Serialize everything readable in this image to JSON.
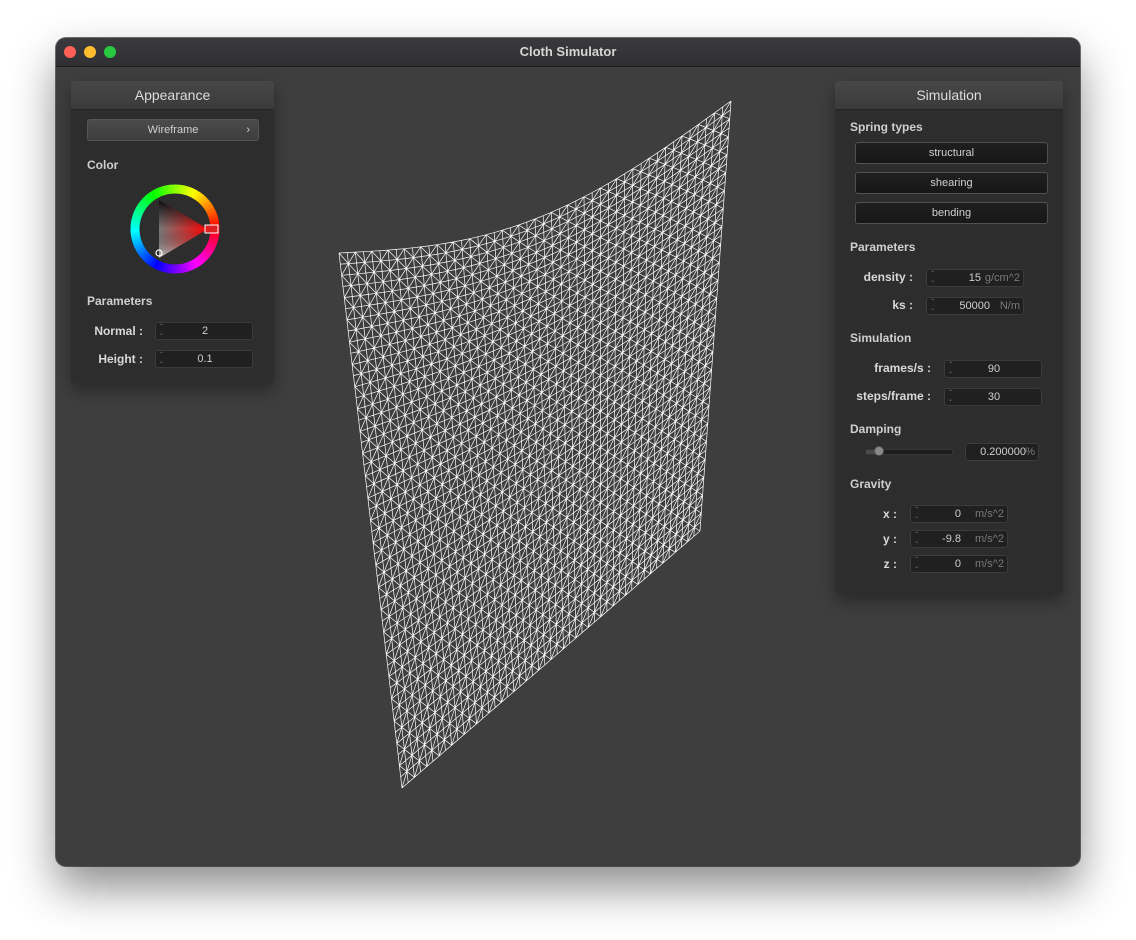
{
  "window": {
    "title": "Cloth Simulator"
  },
  "appearance": {
    "title": "Appearance",
    "mode_button": "Wireframe",
    "color_label": "Color",
    "selected_color": "#ff0000",
    "parameters_label": "Parameters",
    "normal_label": "Normal :",
    "normal_value": "2",
    "height_label": "Height :",
    "height_value": "0.1"
  },
  "simulation": {
    "title": "Simulation",
    "spring_types_label": "Spring types",
    "spring_buttons": [
      "structural",
      "shearing",
      "bending"
    ],
    "parameters_label": "Parameters",
    "density_label": "density :",
    "density_value": "15",
    "density_unit": "g/cm^2",
    "ks_label": "ks :",
    "ks_value": "50000",
    "ks_unit": "N/m",
    "simulation_label": "Simulation",
    "fps_label": "frames/s :",
    "fps_value": "90",
    "steps_label": "steps/frame :",
    "steps_value": "30",
    "damping_label": "Damping",
    "damping_value": "0.200000",
    "damping_unit": "%",
    "damping_fraction": 0.2,
    "gravity_label": "Gravity",
    "gx_label": "x :",
    "gx_value": "0",
    "gy_label": "y :",
    "gy_value": "-9.8",
    "gz_label": "z :",
    "gz_value": "0",
    "gravity_unit": "m/s^2"
  },
  "viewport": {
    "background": "#3e3e3e",
    "mesh_color": "#ffffff",
    "render_mode": "wireframe"
  }
}
